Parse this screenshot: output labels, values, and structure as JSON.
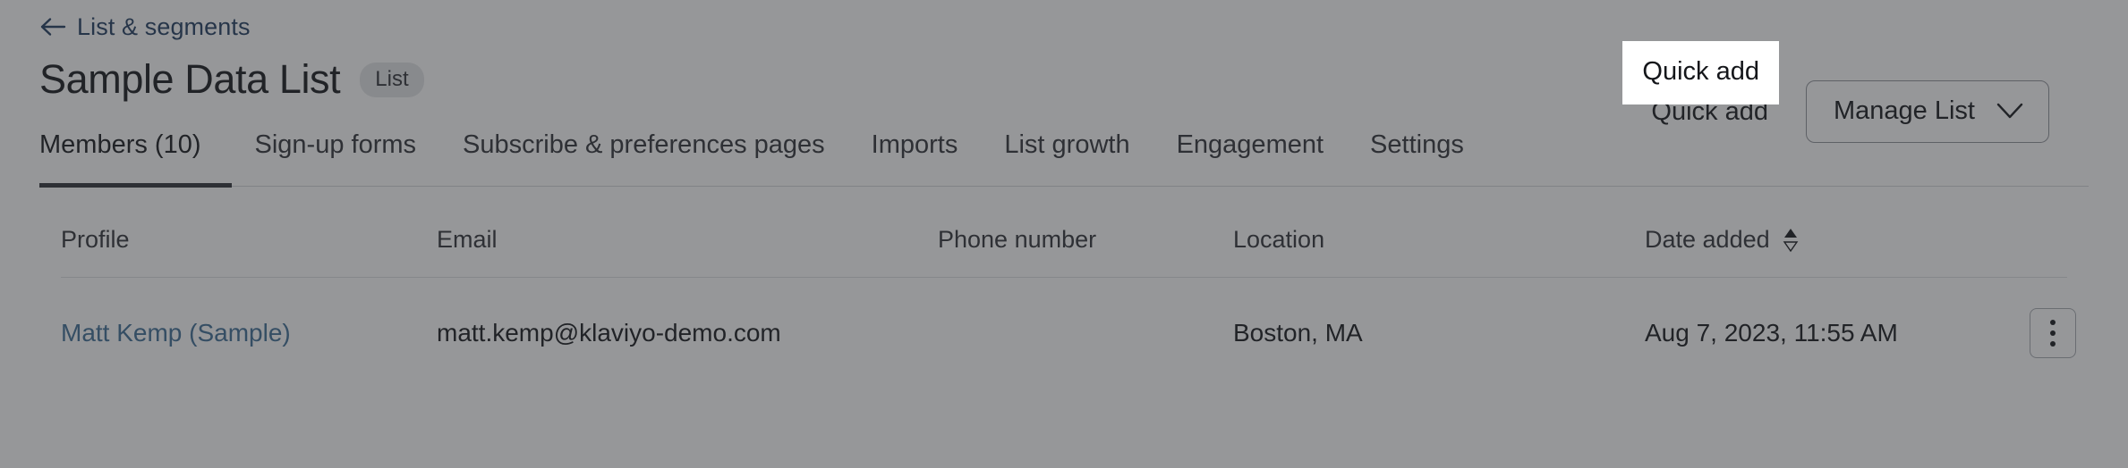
{
  "header": {
    "back_link": {
      "label": "List & segments",
      "icon": "arrow-left-icon",
      "color": "#1f3a5f"
    },
    "title": "Sample Data List",
    "badge": "List",
    "quick_add_label": "Quick add",
    "manage_list_label": "Manage List",
    "chevron_icon": "chevron-down-icon"
  },
  "tabs": [
    {
      "label": "Members (10)",
      "active": true
    },
    {
      "label": "Sign-up forms",
      "active": false
    },
    {
      "label": "Subscribe & preferences pages",
      "active": false
    },
    {
      "label": "Imports",
      "active": false
    },
    {
      "label": "List growth",
      "active": false
    },
    {
      "label": "Engagement",
      "active": false
    },
    {
      "label": "Settings",
      "active": false
    }
  ],
  "table": {
    "columns": [
      {
        "label": "Profile",
        "sortable": false
      },
      {
        "label": "Email",
        "sortable": false
      },
      {
        "label": "Phone number",
        "sortable": false
      },
      {
        "label": "Location",
        "sortable": false
      },
      {
        "label": "Date added",
        "sortable": true,
        "sort_icon": "sort-arrows-icon"
      }
    ],
    "rows": [
      {
        "profile": "Matt Kemp (Sample)",
        "email": "matt.kemp@klaviyo-demo.com",
        "phone": "",
        "location": "Boston, MA",
        "date_added": "Aug 7, 2023, 11:55 AM",
        "menu_icon": "kebab-menu-icon"
      }
    ]
  },
  "overlay": {
    "scrim_color": "#2d2f34",
    "highlight_background": "#ffffff",
    "highlighted_element": "Quick add"
  }
}
